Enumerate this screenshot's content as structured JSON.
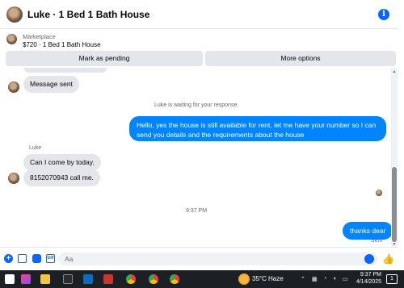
{
  "header": {
    "title": "Luke · 1 Bed 1 Bath House"
  },
  "listing": {
    "category": "Marketplace",
    "item": "$720 · 1 Bed 1 Bath House"
  },
  "actions": {
    "pending_label": "Mark as pending",
    "more_label": "More options"
  },
  "chat": {
    "message_sent_bubble": "Message sent",
    "waiting_notice": "Luke is waiting for your response.",
    "outgoing_reply": "Hello, yes the house is still available for rent, let me have your number so I can send you details and the requirements about the house",
    "sender_name": "Luke",
    "incoming_1": "Can I come by today.",
    "incoming_2": "8152070943  call me.",
    "timestamp": "9:37 PM",
    "outgoing_final": "thanks dear",
    "sent_status": "Sent"
  },
  "composer": {
    "placeholder": "Aa"
  },
  "taskbar": {
    "temperature": "35°C",
    "condition": "Haze",
    "time": "9:37 PM",
    "date": "4/14/2025",
    "notifications": "1"
  },
  "colors": {
    "accent": "#0866ff",
    "outgoing_bubble": "#0084ff",
    "incoming_bubble": "#e4e6eb"
  }
}
